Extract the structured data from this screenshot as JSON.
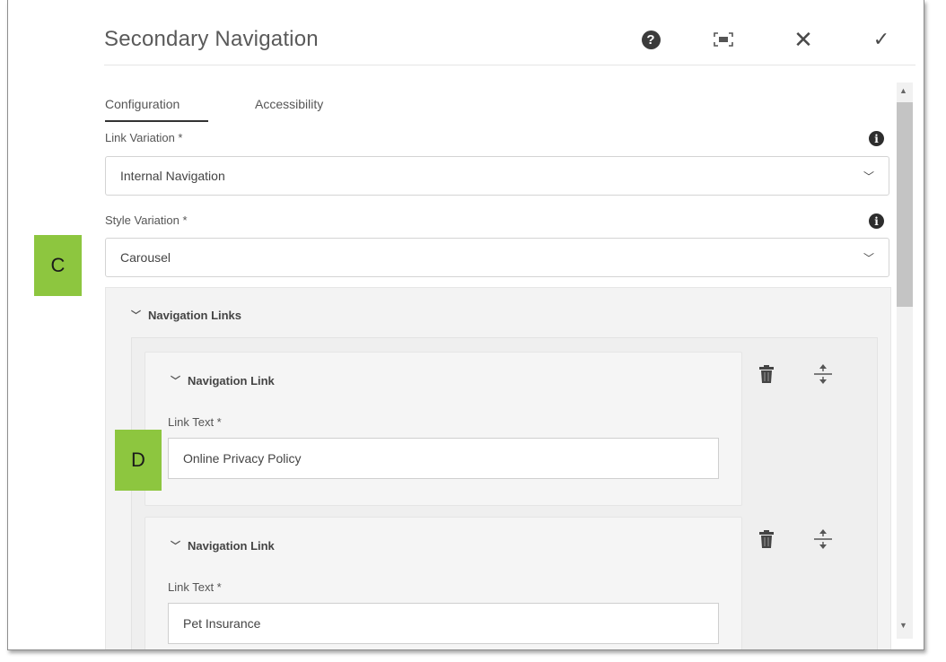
{
  "dialog": {
    "title": "Secondary Navigation",
    "help_label": "?",
    "close_label": "✕",
    "done_label": "✓"
  },
  "tabs": [
    {
      "label": "Configuration",
      "active": true
    },
    {
      "label": "Accessibility",
      "active": false
    }
  ],
  "fields": {
    "link_variation": {
      "label": "Link Variation *",
      "value": "Internal Navigation"
    },
    "style_variation": {
      "label": "Style Variation *",
      "value": "Carousel"
    }
  },
  "annotations": {
    "c": "C",
    "d": "D"
  },
  "navigation_links": {
    "title": "Navigation Links",
    "items": [
      {
        "title": "Navigation Link",
        "field_label": "Link Text *",
        "value": "Online Privacy Policy"
      },
      {
        "title": "Navigation Link",
        "field_label": "Link Text *",
        "value": "Pet Insurance"
      }
    ]
  },
  "icons": {
    "help": "help-circle-icon",
    "fullscreen": "fullscreen-icon",
    "close": "close-icon",
    "done": "checkmark-icon",
    "info": "info-icon",
    "chevron": "chevron-down-icon",
    "delete": "trash-icon",
    "move": "drag-move-icon"
  },
  "colors": {
    "annotation_green": "#8dc63f",
    "panel_bg": "#f3f3f3",
    "border": "#d4d4d4"
  }
}
